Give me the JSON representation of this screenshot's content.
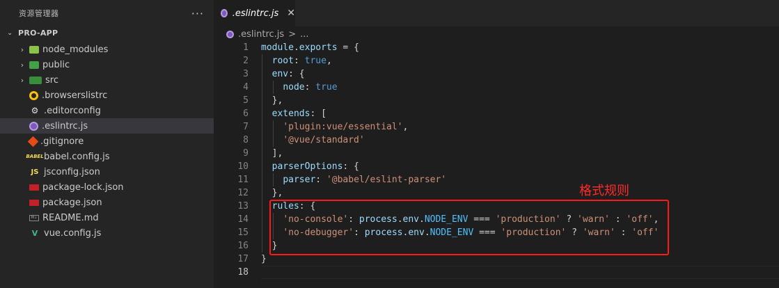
{
  "sidebar": {
    "title": "资源管理器",
    "more": "···",
    "section": "PRO-APP",
    "items": [
      {
        "name": "node_modules",
        "icon": "folder-node-icon",
        "folder": true
      },
      {
        "name": "public",
        "icon": "folder-public-icon",
        "folder": true
      },
      {
        "name": "src",
        "icon": "folder-src-icon",
        "folder": true
      },
      {
        "name": ".browserslistrc",
        "icon": "browserslist-icon",
        "folder": false
      },
      {
        "name": ".editorconfig",
        "icon": "editorconfig-icon",
        "folder": false
      },
      {
        "name": ".eslintrc.js",
        "icon": "eslint-icon",
        "folder": false,
        "selected": true
      },
      {
        "name": ".gitignore",
        "icon": "git-icon",
        "folder": false
      },
      {
        "name": "babel.config.js",
        "icon": "babel-icon",
        "folder": false
      },
      {
        "name": "jsconfig.json",
        "icon": "js-icon",
        "folder": false
      },
      {
        "name": "package-lock.json",
        "icon": "npm-icon",
        "folder": false
      },
      {
        "name": "package.json",
        "icon": "npm-icon",
        "folder": false
      },
      {
        "name": "README.md",
        "icon": "markdown-icon",
        "folder": false
      },
      {
        "name": "vue.config.js",
        "icon": "vue-icon",
        "folder": false
      }
    ]
  },
  "editor": {
    "tab": {
      "label": ".eslintrc.js",
      "close": "✕"
    },
    "breadcrumb": {
      "file": ".eslintrc.js",
      "sep": ">",
      "rest": "..."
    },
    "lines": [
      {
        "n": "1",
        "tokens": [
          [
            "k-var",
            "module"
          ],
          [
            "k-op",
            "."
          ],
          [
            "k-var",
            "exports"
          ],
          [
            "k-op",
            " = {"
          ]
        ]
      },
      {
        "n": "2",
        "tokens": [
          [
            "k-op",
            "  "
          ],
          [
            "k-prop",
            "root"
          ],
          [
            "k-op",
            ": "
          ],
          [
            "k-bool",
            "true"
          ],
          [
            "k-op",
            ","
          ]
        ]
      },
      {
        "n": "3",
        "tokens": [
          [
            "k-op",
            "  "
          ],
          [
            "k-prop",
            "env"
          ],
          [
            "k-op",
            ": {"
          ]
        ]
      },
      {
        "n": "4",
        "tokens": [
          [
            "k-op",
            "    "
          ],
          [
            "k-prop",
            "node"
          ],
          [
            "k-op",
            ": "
          ],
          [
            "k-bool",
            "true"
          ]
        ]
      },
      {
        "n": "5",
        "tokens": [
          [
            "k-op",
            "  },"
          ]
        ]
      },
      {
        "n": "6",
        "tokens": [
          [
            "k-op",
            "  "
          ],
          [
            "k-prop",
            "extends"
          ],
          [
            "k-op",
            ": ["
          ]
        ]
      },
      {
        "n": "7",
        "tokens": [
          [
            "k-op",
            "    "
          ],
          [
            "k-str",
            "'plugin:vue/essential'"
          ],
          [
            "k-op",
            ","
          ]
        ]
      },
      {
        "n": "8",
        "tokens": [
          [
            "k-op",
            "    "
          ],
          [
            "k-str",
            "'@vue/standard'"
          ]
        ]
      },
      {
        "n": "9",
        "tokens": [
          [
            "k-op",
            "  ],"
          ]
        ]
      },
      {
        "n": "10",
        "tokens": [
          [
            "k-op",
            "  "
          ],
          [
            "k-prop",
            "parserOptions"
          ],
          [
            "k-op",
            ": {"
          ]
        ]
      },
      {
        "n": "11",
        "tokens": [
          [
            "k-op",
            "    "
          ],
          [
            "k-prop",
            "parser"
          ],
          [
            "k-op",
            ": "
          ],
          [
            "k-str",
            "'@babel/eslint-parser'"
          ]
        ]
      },
      {
        "n": "12",
        "tokens": [
          [
            "k-op",
            "  },"
          ]
        ]
      },
      {
        "n": "13",
        "tokens": [
          [
            "k-op",
            "  "
          ],
          [
            "k-prop",
            "rules"
          ],
          [
            "k-op",
            ": {"
          ]
        ]
      },
      {
        "n": "14",
        "tokens": [
          [
            "k-op",
            "    "
          ],
          [
            "k-str",
            "'no-console'"
          ],
          [
            "k-op",
            ": "
          ],
          [
            "k-var",
            "process"
          ],
          [
            "k-op",
            "."
          ],
          [
            "k-var",
            "env"
          ],
          [
            "k-op",
            "."
          ],
          [
            "k-const",
            "NODE_ENV"
          ],
          [
            "k-op",
            " === "
          ],
          [
            "k-str",
            "'production'"
          ],
          [
            "k-op",
            " ? "
          ],
          [
            "k-str",
            "'warn'"
          ],
          [
            "k-op",
            " : "
          ],
          [
            "k-str",
            "'off'"
          ],
          [
            "k-op",
            ","
          ]
        ]
      },
      {
        "n": "15",
        "tokens": [
          [
            "k-op",
            "    "
          ],
          [
            "k-str",
            "'no-debugger'"
          ],
          [
            "k-op",
            ": "
          ],
          [
            "k-var",
            "process"
          ],
          [
            "k-op",
            "."
          ],
          [
            "k-var",
            "env"
          ],
          [
            "k-op",
            "."
          ],
          [
            "k-const",
            "NODE_ENV"
          ],
          [
            "k-op",
            " === "
          ],
          [
            "k-str",
            "'production'"
          ],
          [
            "k-op",
            " ? "
          ],
          [
            "k-str",
            "'warn'"
          ],
          [
            "k-op",
            " : "
          ],
          [
            "k-str",
            "'off'"
          ]
        ]
      },
      {
        "n": "16",
        "tokens": [
          [
            "k-op",
            "  }"
          ]
        ]
      },
      {
        "n": "17",
        "tokens": [
          [
            "k-op",
            "}"
          ]
        ]
      },
      {
        "n": "18",
        "tokens": [],
        "active": true
      }
    ]
  },
  "annotation": "格式规则",
  "colors": {
    "highlight": "#ff1a1a",
    "selection": "#37373d"
  }
}
